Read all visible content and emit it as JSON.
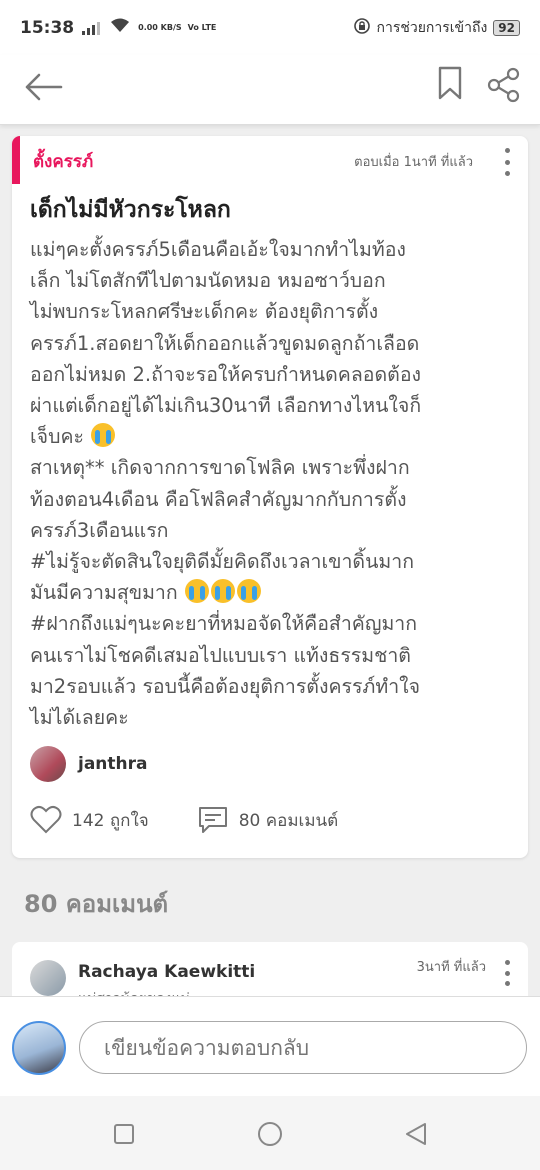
{
  "status_bar": {
    "time": "15:38",
    "net_speed": "0.00 KB/S",
    "volte": "Vo LTE",
    "accessibility": "การช่วยการเข้าถึง",
    "battery": "92"
  },
  "post": {
    "category": "ตั้งครรภ์",
    "time": "ตอบเมื่อ 1นาที ที่แล้ว",
    "title": "เด็กไม่มีหัวกระโหลก",
    "lines": [
      "แม่ๆคะตั้งครรภ์5เดือนคือเอ้ะใจมากทำไมท้อง",
      "เล็ก ไม่โตสักทีไปตามนัดหมอ หมอซาว์บอก",
      "ไม่พบกระโหลกศรีษะเด็กคะ ต้องยุติการตั้ง",
      "ครรภ์1.สอดยาให้เด็กออกแล้วขูดมดลูกถ้าเลือด",
      "ออกไม่หมด 2.ถ้าจะรอให้ครบกำหนดคลอดต้อง",
      "ผ่าแต่เด็กอยู่ได้ไม่เกิน30นาที เลือกทางไหนใจก็",
      "เจ็บคะ",
      "สาเหตุ** เกิดจากการขาดโฟลิค เพราะพึ่งฝาก",
      "ท้องตอน4เดือน คือโฟลิคสำคัญมากกับการตั้ง",
      "ครรภ์3เดือนแรก",
      "#ไม่รู้จะตัดสินใจยุติดีมั้ยคิดถึงเวลาเขาดิ้นมาก",
      "มันมีความสุขมาก",
      "#ฝากถึงแม่ๆนะคะยาที่หมอจัดให้คือสำคัญมาก",
      "คนเราไม่โชคดีเสมอไปแบบเรา แท้งธรรมชาติ",
      "มา2รอบแล้ว รอบนี้คือต้องยุติการตั้งครรภ์ทำใจ",
      "ไม่ได้เลยคะ"
    ],
    "author": "janthra",
    "likes": "142 ถูกใจ",
    "comments": "80 คอมเมนต์"
  },
  "comments_heading": "80 คอมเมนต์",
  "first_comment": {
    "name": "Rachaya Kaewkitti",
    "time": "3นาที ที่แล้ว",
    "preview": "แม่สาวน้อยของแม่"
  },
  "reply": {
    "placeholder": "เขียนข้อความตอบกลับ"
  },
  "colors": {
    "accent": "#e8175d",
    "background": "#efefef"
  }
}
